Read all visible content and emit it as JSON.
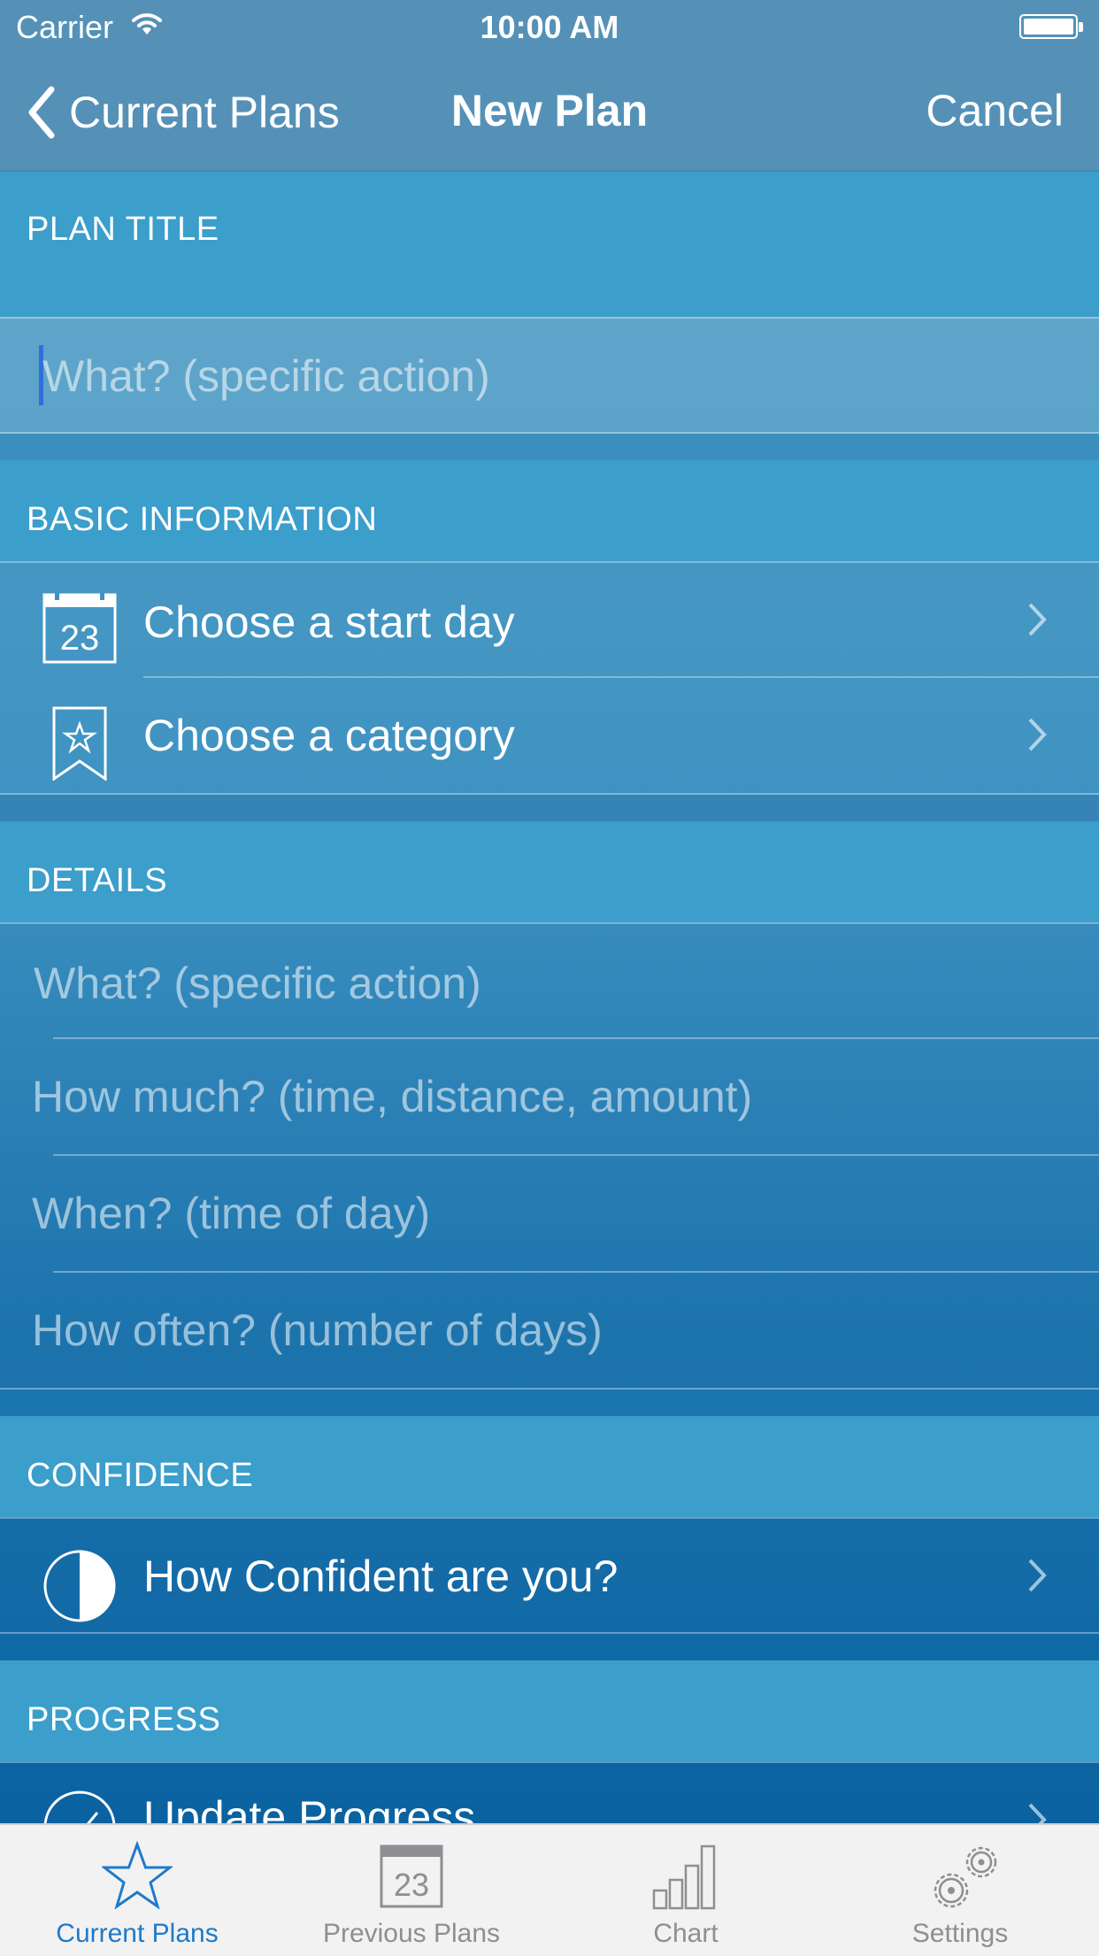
{
  "status_bar": {
    "carrier": "Carrier",
    "time": "10:00 AM"
  },
  "nav": {
    "back_label": "Current Plans",
    "title": "New Plan",
    "cancel_label": "Cancel"
  },
  "plan_title": {
    "header": "PLAN TITLE",
    "input_placeholder": "What? (specific action)"
  },
  "basic_information": {
    "header": "BASIC INFORMATION",
    "start_day_label": "Choose a start day",
    "start_day_icon_number": "23",
    "category_label": "Choose a category"
  },
  "details": {
    "header": "DETAILS",
    "what_placeholder": "What? (specific action)",
    "how_much_placeholder": "How much? (time, distance, amount)",
    "when_placeholder": "When? (time of day)",
    "how_often_placeholder": "How often? (number of days)"
  },
  "confidence": {
    "header": "CONFIDENCE",
    "label": "How Confident are you?"
  },
  "progress": {
    "header": "PROGRESS",
    "label": "Update Progress"
  },
  "tabbar": {
    "tabs": [
      {
        "label": "Current Plans",
        "icon": "star-icon",
        "active": true
      },
      {
        "label": "Previous Plans",
        "icon": "calendar-icon",
        "number": "23"
      },
      {
        "label": "Chart",
        "icon": "bar-chart-icon"
      },
      {
        "label": "Settings",
        "icon": "gears-icon"
      }
    ]
  },
  "colors": {
    "accent": "#1f7ac8",
    "section_header": "#3b9ecb",
    "nav_bar": "#5591b7"
  }
}
